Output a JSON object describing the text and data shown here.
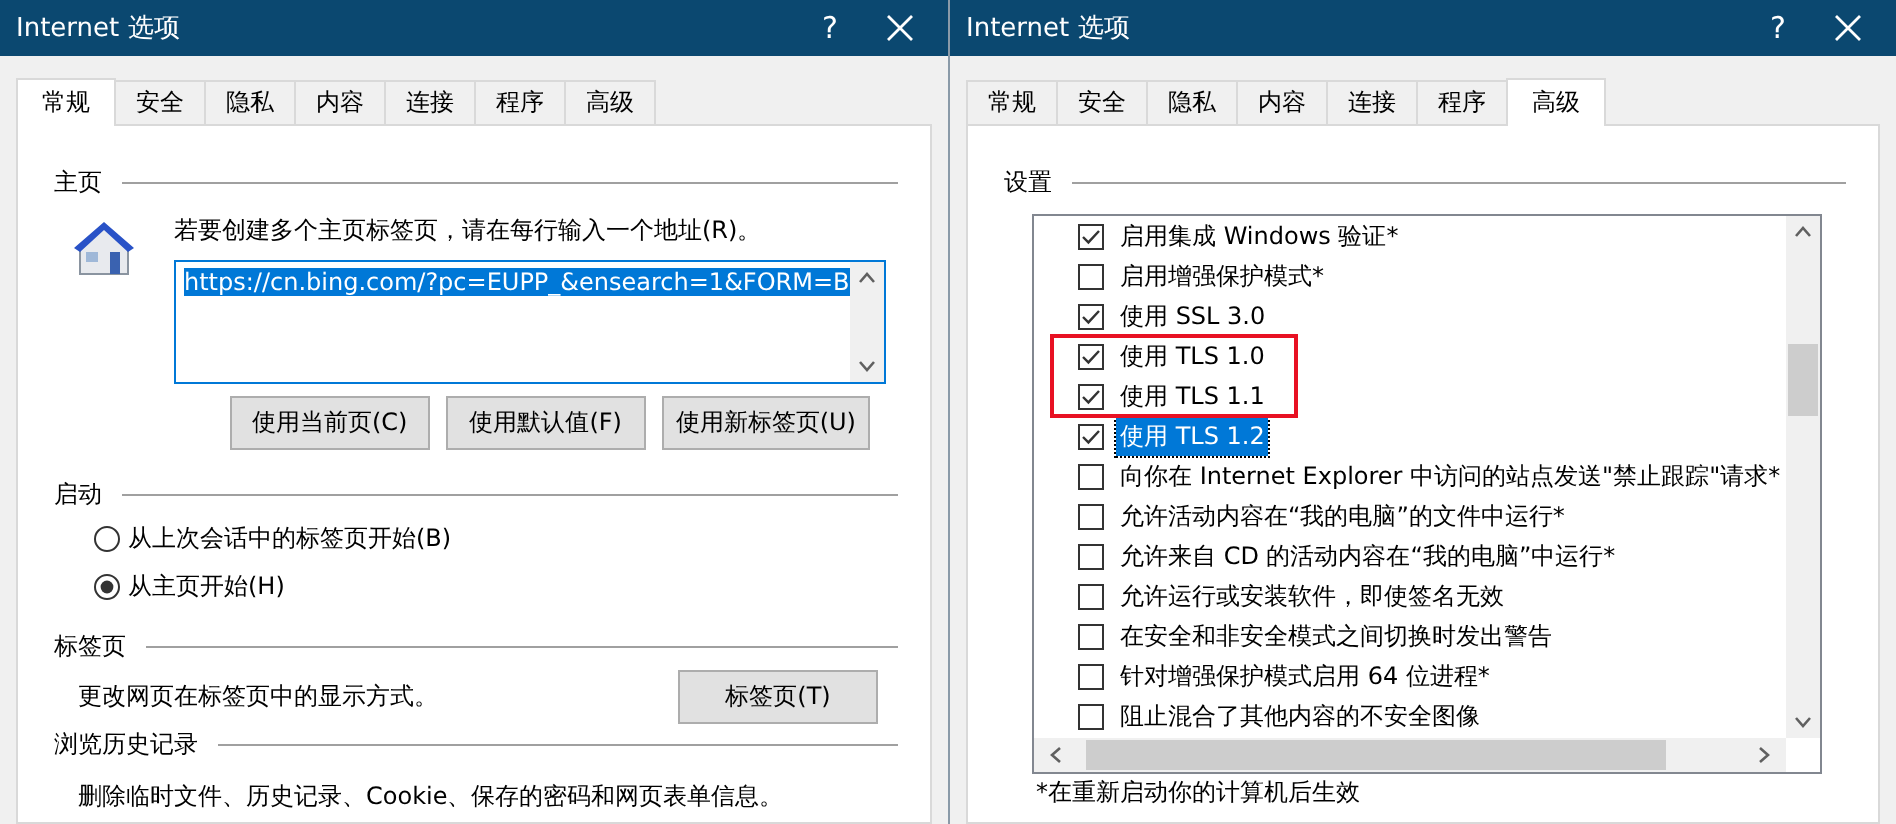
{
  "windows": [
    {
      "kind": "general",
      "title": "Internet 选项",
      "help": "?",
      "tabs": [
        {
          "label": "常规",
          "selected": true
        },
        {
          "label": "安全",
          "selected": false
        },
        {
          "label": "隐私",
          "selected": false
        },
        {
          "label": "内容",
          "selected": false
        },
        {
          "label": "连接",
          "selected": false
        },
        {
          "label": "程序",
          "selected": false
        },
        {
          "label": "高级",
          "selected": false
        }
      ],
      "homepage": {
        "heading": "主页",
        "hint": "若要创建多个主页标签页，请在每行输入一个地址(R)。",
        "url": "https://cn.bing.com/?pc=EUPP_&ensearch=1&FORM=B",
        "url_selected": true,
        "buttons": [
          "使用当前页(C)",
          "使用默认值(F)",
          "使用新标签页(U)"
        ]
      },
      "startup": {
        "heading": "启动",
        "options": [
          {
            "label": "从上次会话中的标签页开始(B)",
            "selected": false
          },
          {
            "label": "从主页开始(H)",
            "selected": true
          }
        ]
      },
      "tabs_section": {
        "heading": "标签页",
        "text": "更改网页在标签页中的显示方式。",
        "button": "标签页(T)"
      },
      "history": {
        "heading": "浏览历史记录",
        "text": "删除临时文件、历史记录、Cookie、保存的密码和网页表单信息。"
      }
    },
    {
      "kind": "advanced",
      "title": "Internet 选项",
      "help": "?",
      "tabs": [
        {
          "label": "常规",
          "selected": false
        },
        {
          "label": "安全",
          "selected": false
        },
        {
          "label": "隐私",
          "selected": false
        },
        {
          "label": "内容",
          "selected": false
        },
        {
          "label": "连接",
          "selected": false
        },
        {
          "label": "程序",
          "selected": false
        },
        {
          "label": "高级",
          "selected": true
        }
      ],
      "settings": {
        "heading": "设置",
        "items": [
          {
            "label": "启用集成 Windows 验证*",
            "checked": true,
            "selected": false,
            "highlighted": false
          },
          {
            "label": "启用增强保护模式*",
            "checked": false,
            "selected": false,
            "highlighted": false
          },
          {
            "label": "使用 SSL 3.0",
            "checked": true,
            "selected": false,
            "highlighted": false
          },
          {
            "label": "使用 TLS 1.0",
            "checked": true,
            "selected": false,
            "highlighted": true
          },
          {
            "label": "使用 TLS 1.1",
            "checked": true,
            "selected": false,
            "highlighted": true
          },
          {
            "label": "使用 TLS 1.2",
            "checked": true,
            "selected": true,
            "highlighted": false
          },
          {
            "label": "向你在 Internet Explorer 中访问的站点发送\"禁止跟踪\"请求*",
            "checked": false,
            "selected": false,
            "highlighted": false
          },
          {
            "label": "允许活动内容在“我的电脑”的文件中运行*",
            "checked": false,
            "selected": false,
            "highlighted": false
          },
          {
            "label": "允许来自 CD 的活动内容在“我的电脑”中运行*",
            "checked": false,
            "selected": false,
            "highlighted": false
          },
          {
            "label": "允许运行或安装软件，即使签名无效",
            "checked": false,
            "selected": false,
            "highlighted": false
          },
          {
            "label": "在安全和非安全模式之间切换时发出警告",
            "checked": false,
            "selected": false,
            "highlighted": false
          },
          {
            "label": "针对增强保护模式启用 64 位进程*",
            "checked": false,
            "selected": false,
            "highlighted": false
          },
          {
            "label": "阻止混合了其他内容的不安全图像",
            "checked": false,
            "selected": false,
            "highlighted": false
          }
        ],
        "footnote": "*在重新启动你的计算机后生效"
      }
    }
  ]
}
